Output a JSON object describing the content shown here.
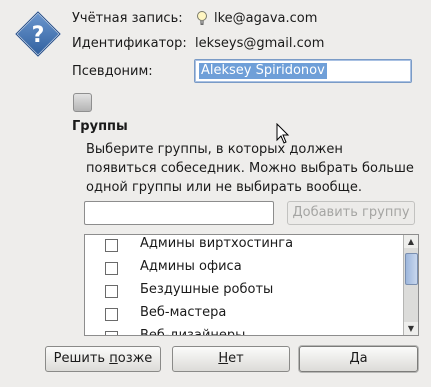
{
  "account": {
    "label": "Учётная запись:",
    "value": "lke@agava.com"
  },
  "identifier": {
    "label": "Идентификатор:",
    "value": "lekseys@gmail.com"
  },
  "nickname": {
    "label": "Псевдоним:",
    "value": "Aleksey Spiridonov"
  },
  "groups": {
    "title": "Группы",
    "description": "Выберите группы, в которых должен появиться собеседник. Можно выбрать больше одной группы или не выбирать вообще.",
    "add_button": "Добавить группу",
    "items": [
      {
        "label": "Админы виртхостинга",
        "checked": false
      },
      {
        "label": "Админы офиса",
        "checked": false
      },
      {
        "label": "Бездушные роботы",
        "checked": false
      },
      {
        "label": "Веб-мастера",
        "checked": false
      },
      {
        "label": "Веб-дизайнеры",
        "checked": false
      }
    ]
  },
  "buttons": {
    "later_before": "Решить ",
    "later_under": "п",
    "later_after": "озже",
    "no_under": "Н",
    "no_after": "ет",
    "yes_under": "Д",
    "yes_after": "а"
  },
  "icons": {
    "dialog": "question-diamond-icon",
    "status": "lightbulb-icon",
    "cursor": "mouse-pointer-icon"
  },
  "colors": {
    "background": "#eeedeb",
    "icon_blue": "#3f6fae",
    "selection": "#6f9fd8"
  }
}
